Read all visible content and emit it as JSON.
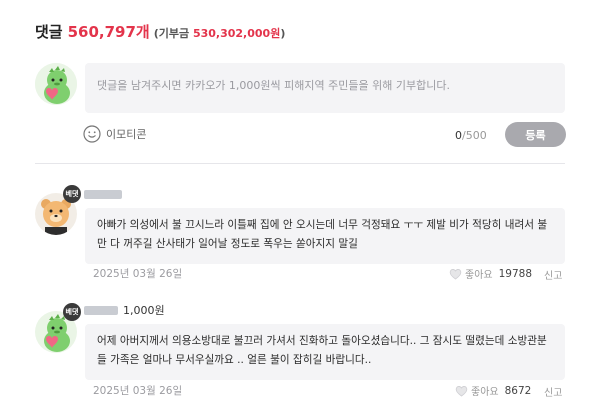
{
  "header": {
    "title": "댓글",
    "count": "560,797개",
    "donation_open": "(기부금 ",
    "donation_amount": "530,302,000원",
    "donation_close": ")"
  },
  "composer": {
    "placeholder": "댓글을 남겨주시면 카카오가 1,000원씩 피해지역 주민들을 위해 기부합니다.",
    "emoticon_label": "이모티콘",
    "char_current": "0",
    "char_max": "/500",
    "submit_label": "등록"
  },
  "comments": [
    {
      "badge": "베댓",
      "lines": [
        "아빠가 의성에서 불 끄시느라 이틀째 집에 안 오시는데 너무 걱정돼요 ㅜㅜ 제발 비가 적당히 내려서 불",
        "만 다 꺼주길 산사태가 일어날 정도로 폭우는 쏟아지지 말길"
      ],
      "date": "2025년 03월 26일",
      "like_label": "좋아요",
      "like_count": "19788",
      "report_label": "신고"
    },
    {
      "badge": "베댓",
      "donation": "1,000원",
      "lines": [
        "어제 아버지께서 의용소방대로 불끄러 가셔서 진화하고 돌아오셨습니다.. 그 잠시도 떨렸는데 소방관분",
        "들 가족은 얼마나 무서우실까요 .. 얼른 불이 잡히길 바랍니다.."
      ],
      "date": "2025년 03월 26일",
      "like_label": "좋아요",
      "like_count": "8672",
      "report_label": "신고"
    }
  ],
  "icons": {
    "emoticon": "smiley-face-icon",
    "like": "heart-outline-icon",
    "avatar_default": "green-dinosaur-avatar",
    "avatar_user1": "orange-bear-avatar"
  },
  "colors": {
    "accent_red": "#e3344b",
    "submit_gray": "#a9a9ae",
    "bubble_bg": "#f4f4f6"
  }
}
